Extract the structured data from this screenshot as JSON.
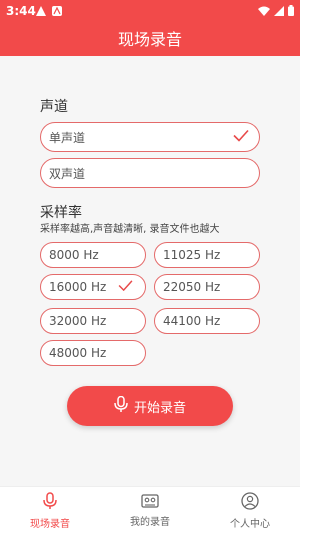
{
  "status": {
    "time": "3:44"
  },
  "title": "现场录音",
  "channel": {
    "title": "声道",
    "options": [
      {
        "label": "单声道",
        "selected": true
      },
      {
        "label": "双声道",
        "selected": false
      }
    ]
  },
  "sample_rate": {
    "title": "采样率",
    "note": "采样率越高,声音越清晰, 录音文件也越大",
    "options": [
      {
        "label": "8000 Hz",
        "selected": false
      },
      {
        "label": "11025 Hz",
        "selected": false
      },
      {
        "label": "16000 Hz",
        "selected": true
      },
      {
        "label": "22050 Hz",
        "selected": false
      },
      {
        "label": "32000 Hz",
        "selected": false
      },
      {
        "label": "44100 Hz",
        "selected": false
      },
      {
        "label": "48000 Hz",
        "selected": false
      }
    ]
  },
  "record_button": {
    "label": "开始录音"
  },
  "nav": {
    "items": [
      {
        "label": "现场录音",
        "icon": "mic-icon",
        "active": true
      },
      {
        "label": "我的录音",
        "icon": "tape-icon",
        "active": false
      },
      {
        "label": "个人中心",
        "icon": "user-icon",
        "active": false
      }
    ]
  },
  "colors": {
    "accent": "#f24a4a",
    "border": "#e46a6a",
    "background": "#f6f6f6"
  }
}
